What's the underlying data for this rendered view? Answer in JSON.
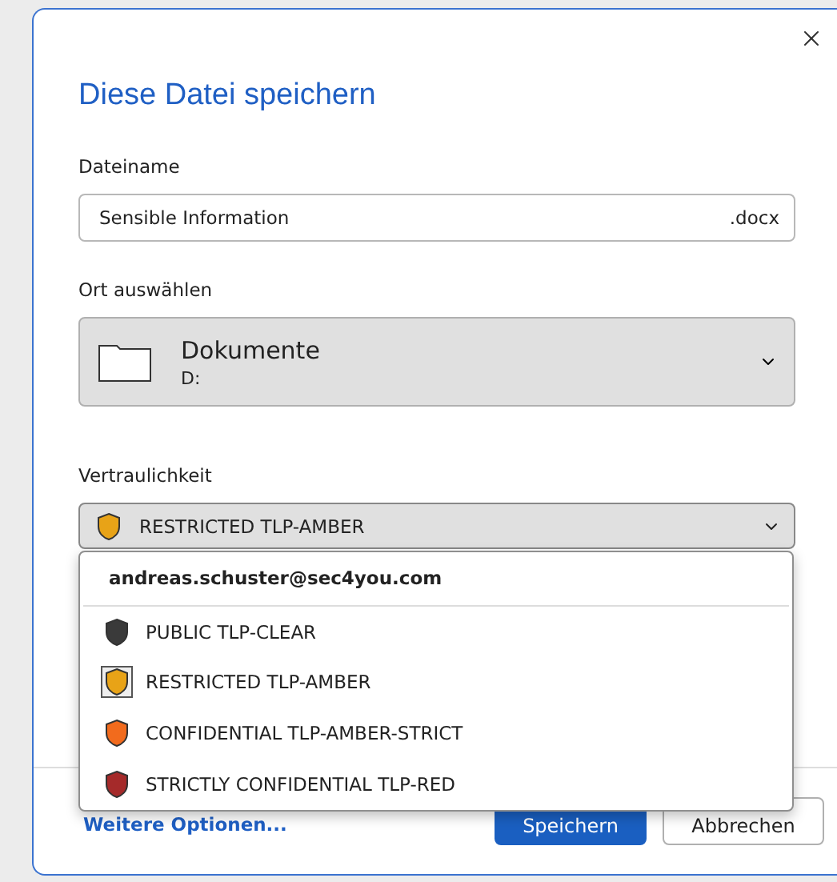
{
  "dialog": {
    "title": "Diese Datei speichern"
  },
  "filename": {
    "label": "Dateiname",
    "value": "Sensible Information",
    "extension": ".docx"
  },
  "location": {
    "label": "Ort auswählen",
    "name": "Dokumente",
    "path": "D:"
  },
  "sensitivity": {
    "label": "Vertraulichkeit",
    "value": "RESTRICTED TLP-AMBER",
    "color": "#e8a317",
    "expanded": true,
    "menu": {
      "account": "andreas.schuster@sec4you.com",
      "options": [
        {
          "label": "PUBLIC TLP-CLEAR",
          "color": "#3a3a3a",
          "selected": false
        },
        {
          "label": "RESTRICTED TLP-AMBER",
          "color": "#e8a317",
          "selected": true
        },
        {
          "label": "CONFIDENTIAL TLP-AMBER-STRICT",
          "color": "#f26b1d",
          "selected": false
        },
        {
          "label": "STRICTLY CONFIDENTIAL TLP-RED",
          "color": "#a52a2a",
          "selected": false
        }
      ]
    }
  },
  "footer": {
    "link": "Weitere Optionen...",
    "buttons": [
      {
        "label": "Speichern",
        "kind": "primary"
      },
      {
        "label": "Abbrechen",
        "kind": "secondary"
      }
    ]
  }
}
